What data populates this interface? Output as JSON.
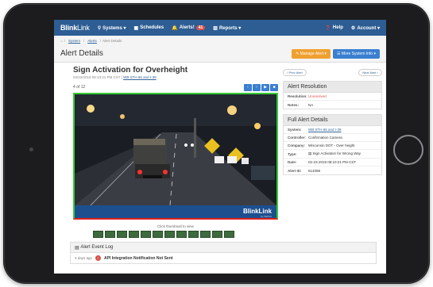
{
  "nav": {
    "brand_1": "Blink",
    "brand_2": "Link",
    "items": [
      {
        "icon": "sitemap-icon",
        "label": "Systems ▾"
      },
      {
        "icon": "calendar-icon",
        "label": "Schedules"
      },
      {
        "icon": "bell-icon",
        "label": "Alerts!"
      },
      {
        "icon": "chart-icon",
        "label": "Reports ▾"
      }
    ],
    "alerts_count": "41",
    "help": "Help",
    "account": "Account ▾"
  },
  "breadcrumb": [
    "System",
    "Alerts",
    "Alert Details"
  ],
  "page": {
    "title": "Alert Details",
    "manage_alert": "Manage Alert ▾",
    "more_system_info": "More System Info ▾"
  },
  "alert": {
    "title": "Sign Activation for Overheight",
    "timestamp": "02/23/2019 08:10:21 PM CST",
    "system_link": "WB STH 66 and I-39",
    "counter": "4 of 12"
  },
  "image": {
    "footer_logo": "BlinkLink",
    "footer_sub": "by TAPCO"
  },
  "thumbnails": {
    "caption": "Click thumbnail to view",
    "count": 12
  },
  "pager": {
    "prev": "Prev Alert",
    "next": "Next Alert"
  },
  "resolution": {
    "title": "Alert Resolution",
    "rows": [
      {
        "label": "Resolution:",
        "value": "Unresolved"
      },
      {
        "label": "Notes:",
        "value": "NA"
      }
    ]
  },
  "details": {
    "title": "Full Alert Details",
    "rows": [
      {
        "label": "System:",
        "value": "WB STH 66 and I-39"
      },
      {
        "label": "Controller:",
        "value": "Confirmation Camera"
      },
      {
        "label": "Company:",
        "value": "Wisconsin DOT - Over height"
      },
      {
        "label": "Type:",
        "value": "Sign Activation for Wrong Way"
      },
      {
        "label": "Date:",
        "value": "02-23-2019 08:10:21 PM CST"
      },
      {
        "label": "Alert ID:",
        "value": "614098"
      }
    ]
  },
  "log": {
    "title": "Alert Event Log",
    "entry_age": "3 days ago",
    "entry_text": "API Integration Notification Not Sent"
  },
  "colors": {
    "navbar": "#2d5d93",
    "accent_blue": "#3a7fd0",
    "accent_orange": "#f0a030",
    "unresolved_red": "#d9534f",
    "frame_green": "#33cc33"
  }
}
